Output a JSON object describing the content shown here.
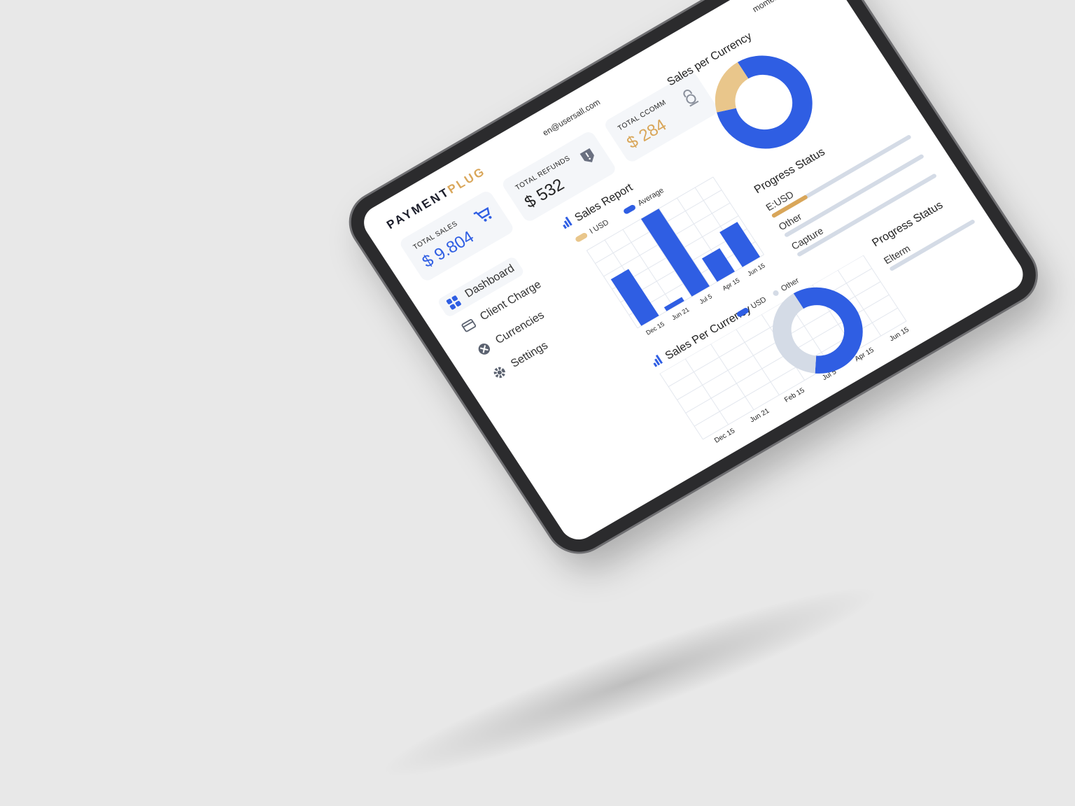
{
  "brand": {
    "name_part1": "PAYMENT",
    "name_part2": "PLUG"
  },
  "header": {
    "email": "en@usersall.com",
    "user": "momentliant ⌄"
  },
  "cards": [
    {
      "label": "TOTAL SALES",
      "value": "$ 9.804",
      "icon": "cart-icon",
      "color": "#2f5ee3"
    },
    {
      "label": "TOTAL REFUNDS",
      "value": "$ 532",
      "icon": "refund-tag-icon",
      "color": "#222222"
    },
    {
      "label": "TOTAL CCOMM",
      "value": "$ 284",
      "icon": "lock-icon",
      "color": "#d9a659"
    }
  ],
  "nav": [
    {
      "label": "Dashboard",
      "icon": "dashboard-icon",
      "active": true
    },
    {
      "label": "Client Charge",
      "icon": "card-icon"
    },
    {
      "label": "Currencies",
      "icon": "currency-icon"
    },
    {
      "label": "Settings",
      "icon": "gear-icon"
    }
  ],
  "sales_report": {
    "title": "Sales Report",
    "legend": [
      "I USD",
      "Average"
    ]
  },
  "sales_per_currency_top": {
    "title": "Sales per Currency"
  },
  "progress_top": {
    "title": "Progress Status",
    "items": [
      {
        "label": "E:USD",
        "fill": 0.25,
        "color": "#d9a659"
      },
      {
        "label": "Other",
        "fill": 0,
        "color": "#d4dbe6"
      },
      {
        "label": "Capture",
        "fill": 0,
        "color": "#d4dbe6"
      }
    ]
  },
  "sales_per_currency_bottom": {
    "title": "Sales Per Currency",
    "legend": [
      "USD",
      "Other"
    ]
  },
  "progress_bottom": {
    "title": "Progress Status",
    "items": [
      {
        "label": "Elterm",
        "fill": 0,
        "color": "#d4dbe6"
      }
    ]
  },
  "colors": {
    "accent": "#2f5ee3",
    "gold": "#d9a659",
    "grey": "#d4dbe6"
  },
  "chart_data": [
    {
      "type": "bar",
      "title": "Sales Report",
      "categories": [
        "Dec 15",
        "Jun 21",
        "Jul 5",
        "Apr 15",
        "Jun 15"
      ],
      "series": [
        {
          "name": "I USD",
          "values": [
            60,
            5,
            100,
            30,
            45
          ]
        }
      ],
      "ylim": [
        0,
        100
      ],
      "grid": true
    },
    {
      "type": "pie",
      "title": "Sales per Currency",
      "labels": [
        "Blue",
        "Gold"
      ],
      "values": [
        80,
        20
      ],
      "colors": [
        "#2f5ee3",
        "#e9c68b"
      ]
    },
    {
      "type": "pie",
      "title": "Sales Per Currency",
      "labels": [
        "USD",
        "Other"
      ],
      "values": [
        60,
        40
      ],
      "colors": [
        "#2f5ee3",
        "#d4dbe6"
      ]
    },
    {
      "type": "line",
      "title": "",
      "x": [
        "Dec 15",
        "Jun 21",
        "Feb 15",
        "Jul 5",
        "Apr 15",
        "Jun 15"
      ],
      "series": [],
      "grid": true
    }
  ]
}
